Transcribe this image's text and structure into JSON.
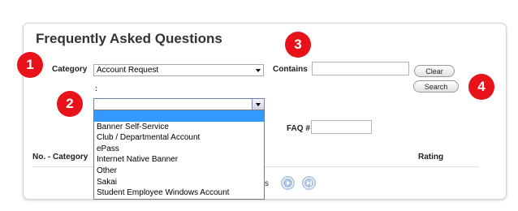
{
  "header": {
    "title": "Frequently Asked Questions"
  },
  "filters": {
    "category_label": "Category",
    "category_value": "Account Request",
    "subcategory_label": ":",
    "subcategory_value": "",
    "contains_label": "Contains",
    "contains_value": "",
    "faq_label": "FAQ #",
    "faq_value": "",
    "clear_label": "Clear",
    "search_label": "Search"
  },
  "dropdown": {
    "items": [
      "",
      "Banner Self-Service",
      "Club / Departmental Account",
      "ePass",
      "Internet Native Banner",
      "Other",
      "Sakai",
      "Student Employee Windows Account"
    ],
    "selected_index": 0
  },
  "table": {
    "col_left": "No. - Category",
    "col_rating": "Rating"
  },
  "pager": {
    "text_fragment": "s"
  },
  "badges": [
    "1",
    "2",
    "3",
    "4"
  ],
  "colors": {
    "badge": "#e8121b",
    "selection": "#3399ff",
    "nav_button": "#a9c3e0"
  }
}
